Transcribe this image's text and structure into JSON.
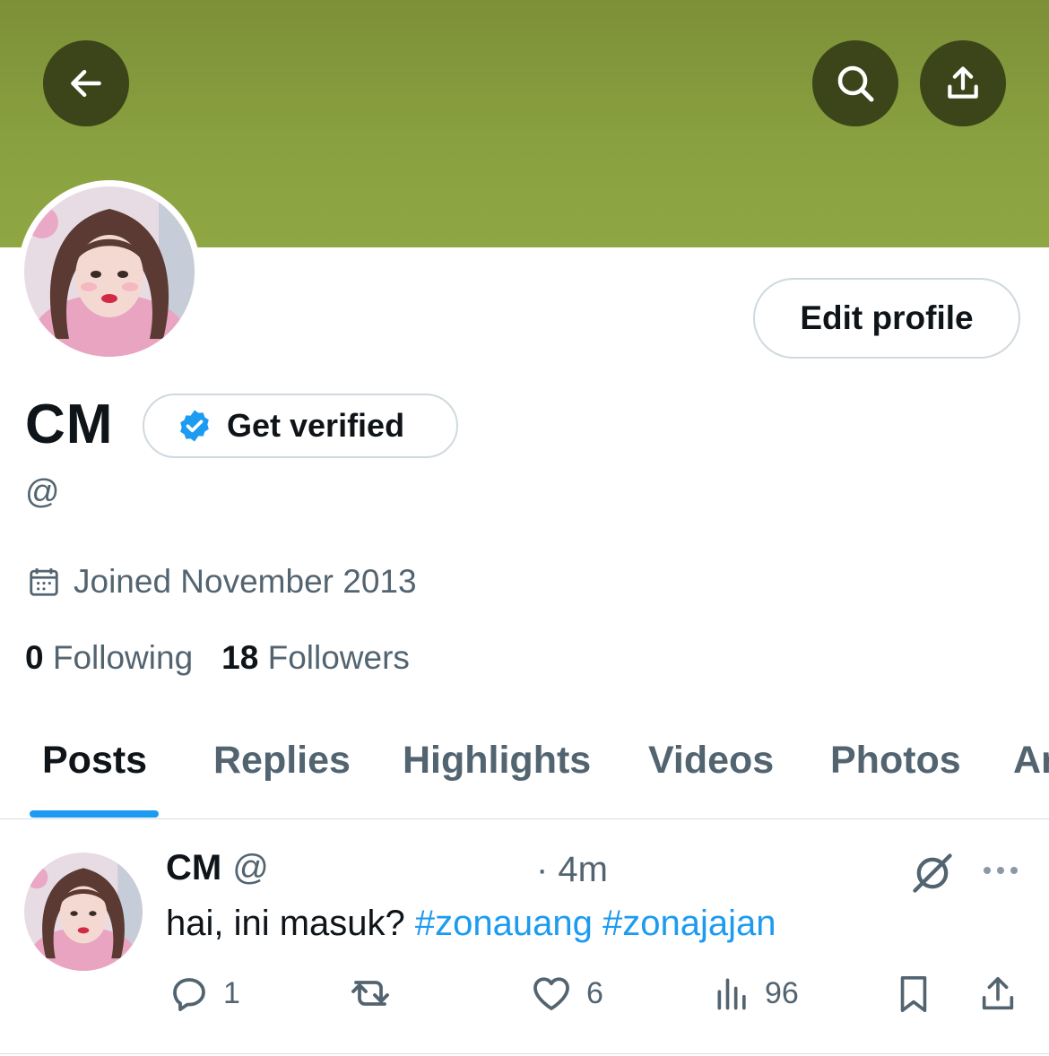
{
  "header": {
    "back_icon": "arrow-left-icon",
    "search_icon": "search-icon",
    "share_icon": "share-icon",
    "banner_color": "#88a03f"
  },
  "profile": {
    "name": "CM",
    "get_verified_label": "Get verified",
    "handle": "@",
    "joined": "Joined November 2013",
    "following_count": "0",
    "following_label": "Following",
    "followers_count": "18",
    "followers_label": "Followers",
    "edit_profile_label": "Edit profile"
  },
  "tabs": [
    {
      "label": "Posts",
      "active": true
    },
    {
      "label": "Replies"
    },
    {
      "label": "Highlights"
    },
    {
      "label": "Videos"
    },
    {
      "label": "Photos"
    },
    {
      "label": "Ar"
    }
  ],
  "post": {
    "name": "CM",
    "handle": "@",
    "time": "· 4m",
    "text": "hai, ini masuk?",
    "hashtags": [
      "#zonauang",
      "#zonajajan"
    ],
    "replies": "1",
    "reposts": "",
    "likes": "6",
    "views": "96"
  },
  "colors": {
    "accent": "#1d9bf0",
    "secondary_text": "#536471",
    "button_dark": "#3b4519"
  }
}
